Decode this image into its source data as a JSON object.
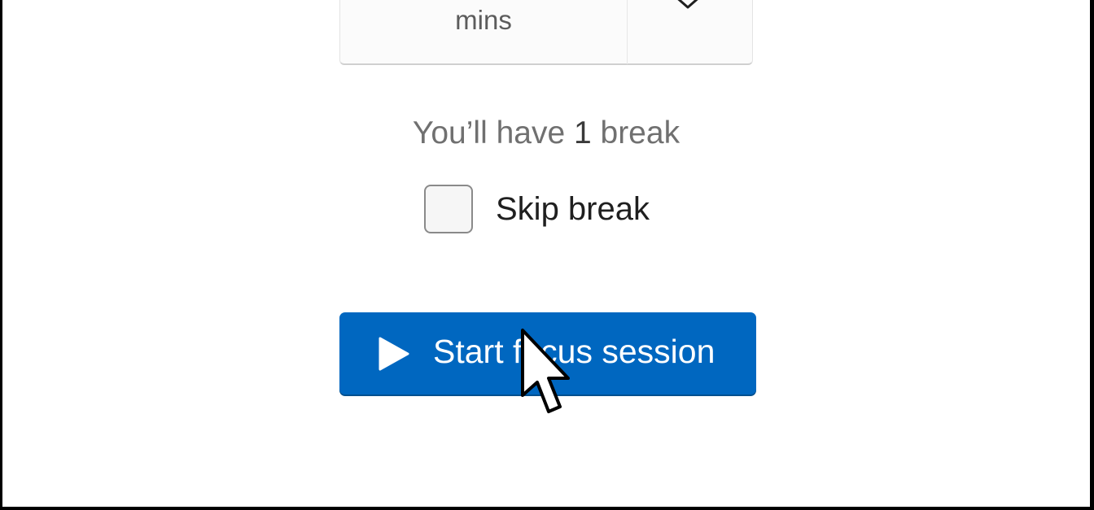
{
  "duration": {
    "unit": "mins"
  },
  "break_summary": {
    "prefix": "You’ll have ",
    "count": "1",
    "suffix": " break"
  },
  "skip_break": {
    "label": "Skip break",
    "checked": false
  },
  "start_button": {
    "label": "Start focus session"
  },
  "icons": {
    "spinner": "chevron-down-icon",
    "start": "play-icon",
    "pointer": "mouse-cursor-icon"
  },
  "colors": {
    "accent": "#0067c0",
    "background": "#ffffff",
    "frame": "#000000"
  }
}
